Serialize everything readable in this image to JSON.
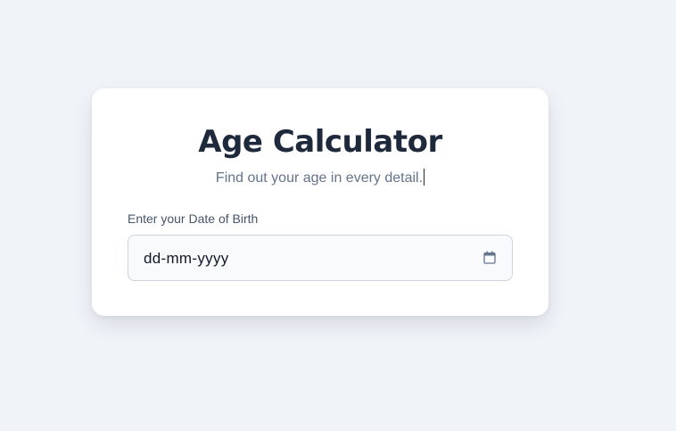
{
  "card": {
    "title": "Age Calculator",
    "subtitle": "Find out your age in every detail.",
    "dob_label": "Enter your Date of Birth",
    "dob_input": {
      "placeholder": "dd-mm-yyyy",
      "value": ""
    },
    "calendar_icon": "calendar-icon"
  },
  "colors": {
    "page_background": "#f0f3f8",
    "card_background": "#ffffff",
    "title": "#1e293b",
    "subtitle": "#64748b",
    "input_border": "#cbd5e1",
    "input_background": "#f8fafc"
  }
}
